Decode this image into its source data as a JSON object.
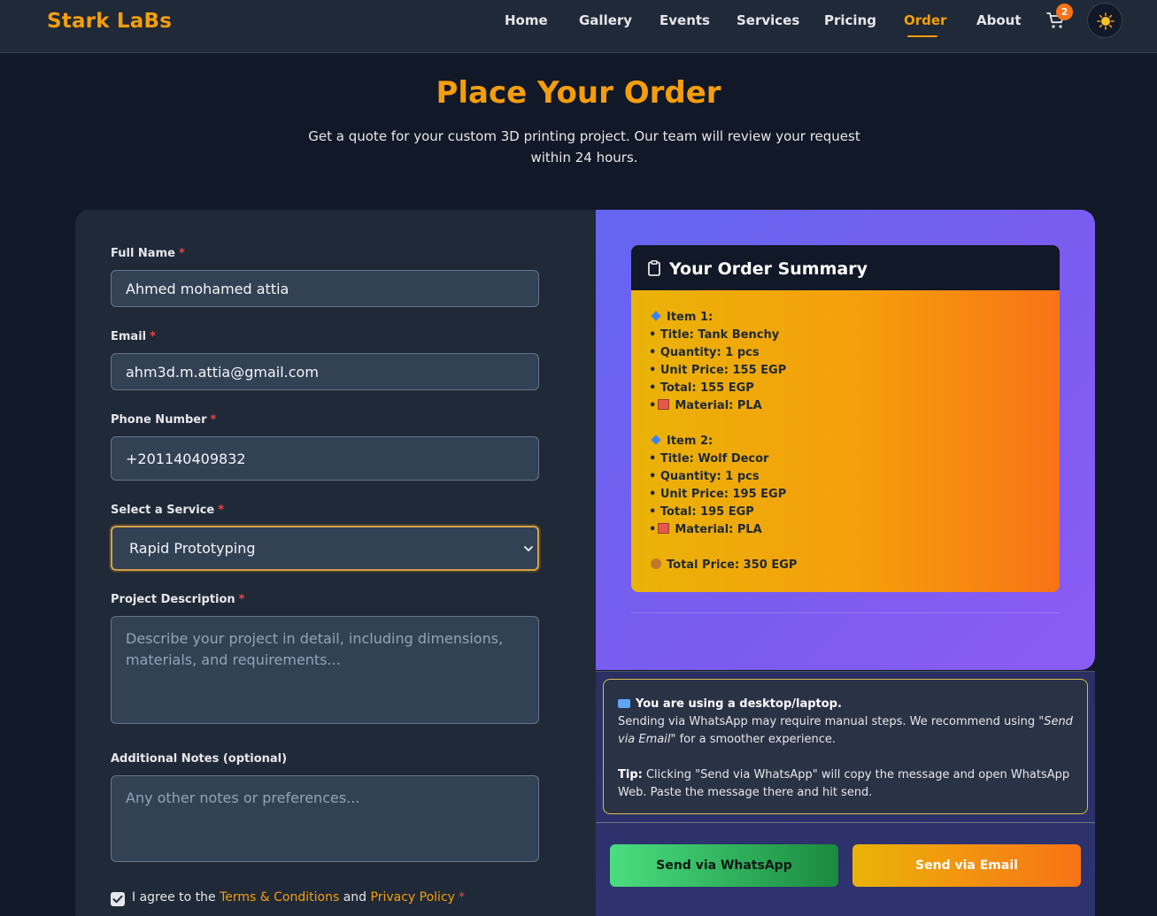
{
  "nav": {
    "brand": "Stark LaBs",
    "links": [
      "Home",
      "Gallery",
      "Events",
      "Services",
      "Pricing",
      "Order",
      "About"
    ],
    "active": "Order",
    "cart_count": "2",
    "accent": "#f59e0b"
  },
  "hero": {
    "title": "Place Your Order",
    "subtitle": "Get a quote for your custom 3D printing project. Our team will review your request within 24 hours."
  },
  "form": {
    "full_name_label": "Full Name",
    "full_name_value": "Ahmed mohamed attia",
    "email_label": "Email",
    "email_value": "ahm3d.m.attia@gmail.com",
    "phone_label": "Phone Number",
    "phone_value": "+201140409832",
    "service_label": "Select a Service",
    "service_value": "Rapid Prototyping",
    "description_label": "Project Description",
    "description_placeholder": "Describe your project in detail, including dimensions, materials, and requirements...",
    "notes_label": "Additional Notes (optional)",
    "notes_placeholder": "Any other notes or preferences...",
    "required_mark": "*",
    "agree_prefix": "I agree to the",
    "terms_link": "Terms & Conditions",
    "agree_and": "and",
    "privacy_link": "Privacy Policy",
    "agree_checked": true
  },
  "summary": {
    "title": "Your Order Summary",
    "items": [
      {
        "heading": "Item 1:",
        "title": "• Title: Tank Benchy",
        "quantity": "• Quantity: 1 pcs",
        "unit_price": "• Unit Price: 155 EGP",
        "total": "• Total: 155 EGP",
        "material": "Material: PLA"
      },
      {
        "heading": "Item 2:",
        "title": "• Title: Wolf Decor",
        "quantity": "• Quantity: 1 pcs",
        "unit_price": "• Unit Price: 195 EGP",
        "total": "• Total: 195 EGP",
        "material": "Material: PLA"
      }
    ],
    "total_price": "Total Price: 350 EGP"
  },
  "notice": {
    "heading": "You are using a desktop/laptop.",
    "body_prefix": "Sending via WhatsApp may require manual steps. We recommend using \"",
    "body_em": "Send via Email",
    "body_suffix": "\" for a smoother experience.",
    "tip_label": "Tip:",
    "tip_text": "Clicking \"Send via WhatsApp\" will copy the message and open WhatsApp Web. Paste the message there and hit send."
  },
  "actions": {
    "whatsapp_label": "Send via WhatsApp",
    "email_label": "Send via Email"
  }
}
